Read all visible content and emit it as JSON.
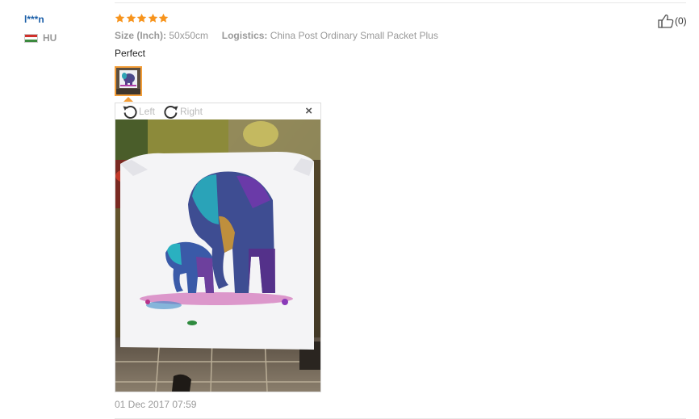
{
  "review": {
    "user_name": "l***n",
    "country": "HU",
    "rating": 5,
    "attributes": [
      {
        "key": "Size (Inch):",
        "value": "50x50cm"
      },
      {
        "key": "Logistics:",
        "value": "China Post Ordinary Small Packet Plus"
      }
    ],
    "text": "Perfect",
    "date": "01 Dec 2017 07:59",
    "likes": "(0)"
  },
  "viewer": {
    "rotate_left_label": "Left",
    "rotate_right_label": "Right",
    "close_label": "×"
  },
  "colors": {
    "link": "#1a5ea8",
    "star": "#f7941d",
    "thumb_border": "#f29d38",
    "muted": "#999999"
  }
}
